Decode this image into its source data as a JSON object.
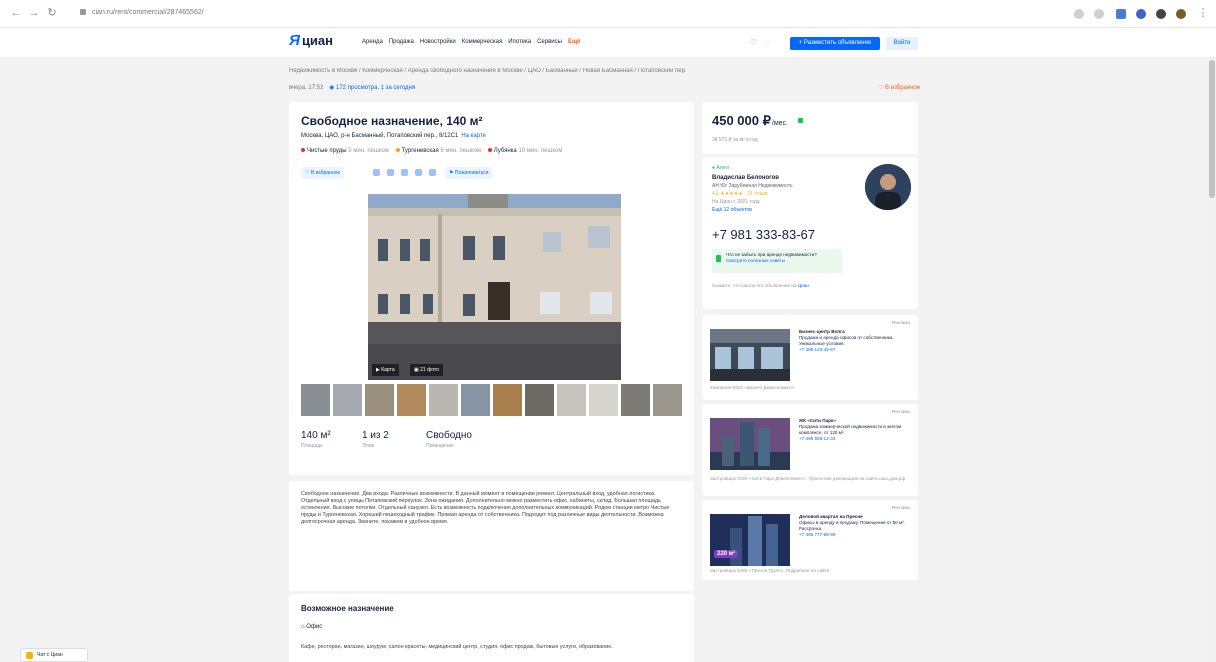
{
  "browser": {
    "back": "←",
    "forward": "→",
    "reload": "↻",
    "url": "cian.ru/rent/commercial/287465562/"
  },
  "header": {
    "logo_text": "циан",
    "menu": [
      "Аренда",
      "Продажа",
      "Новостройки",
      "Коммерческая",
      "Ипотека",
      "Сервисы"
    ],
    "menu_hot": "Ещё",
    "place_ad": "+ Разместить объявление",
    "login": "Войти"
  },
  "breadcrumbs": "Недвижимость в Москве / Коммерческая / Аренда свободного назначения в Москве / ЦАО / Басманный / Новая Басманная / Потаповский пер.",
  "meta": {
    "updated": "вчера, 17:52",
    "views": "172 просмотра, 1 за сегодня"
  },
  "favorites": "В избранное",
  "listing": {
    "title": "Свободное назначение, 140 м²",
    "address": "Москва, ЦАО, р-н Басманный, Потаповский пер., 8/12С1",
    "map_link": "На карте",
    "metro": [
      {
        "name": "Чистые пруды",
        "time": "5 мин. пешком",
        "color": "#e4312a"
      },
      {
        "name": "Тургеневская",
        "time": "6 мин. пешком",
        "color": "#f0a325"
      },
      {
        "name": "Лубянка",
        "time": "10 мин. пешком",
        "color": "#e4312a"
      }
    ],
    "actions": {
      "favorite": "В избранное",
      "report": "Пожаловаться"
    },
    "gallery": {
      "map_button": "Карта",
      "photos_button": "21 фото"
    },
    "params": [
      {
        "value": "140 м²",
        "label": "Площадь"
      },
      {
        "value": "1 из 2",
        "label": "Этаж"
      },
      {
        "value": "Свободно",
        "label": "Помещение"
      }
    ],
    "description": "Свободное назначение. Два входа. Различные возможности. В данный момент в помещении ремонт. Центральный вход, удобная логистика. Отдельный вход с улицы Потаповский переулок. Зона ожидания. Дополнительно можно разместить офис, кабинеты, склад. Большая площадь остекления. Высокие потолки. Отдельный санузел. Есть возможность подключения дополнительных коммуникаций. Рядом станции метро Чистые пруды и Тургеневская. Хороший пешеходный трафик. Прямая аренда от собственника. Подходит под различные виды деятельности. Возможна долгосрочная аренда. Звоните, покажем в удобное время.",
    "extra_title": "Возможное назначение",
    "extra_tag": "Офис",
    "extra_text": "Кафе, ресторан, магазин, шоурум, салон красоты, медицинский центр, студия, офис продаж, бытовые услуги, образование."
  },
  "sidebar": {
    "price": "450 000 ₽",
    "price_unit": "/мес.",
    "price_sub": "38 571 ₽ за м² в год",
    "agent": {
      "badge": "Агент",
      "name": "Владислав Белоногов",
      "company": "АН Юг Зарубежная Недвижимость",
      "rating": "4,5 ★★★★★ · 21 отзыв",
      "since": "На Циан с 2021 года",
      "more": "Ещё 12 объектов",
      "phone": "+7 981 333-83-67",
      "safe_text": "Что не забыть при аренде недвижимости?",
      "safe_link": "Смотрите полезные советы",
      "note": "Скажите, что нашли это объявление на",
      "note_link": "Циан"
    },
    "ads": [
      {
        "label": "Реклама",
        "title": "Бизнес-центр Волга",
        "text": "Продажа и аренда офисов от собственника. Уникальные условия.",
        "phone": "+7 495 123-45-67",
        "footer": "Компания ООО «Бизнес-Девелопмент»"
      },
      {
        "label": "Реклама",
        "title": "ЖК «Сити Парк»",
        "text": "Продажа коммерческой недвижимости в жилом комплексе, от 120 м².",
        "phone": "+7 495 555-12-34",
        "footer": "Застройщик ООО «Сити Парк Девелопмент». Проектная декларация на сайте наш.дом.рф"
      },
      {
        "label": "Реклама",
        "title": "Деловой квартал на Пресне",
        "text": "Офисы в аренду и продажу. Помещения от 50 м². Рассрочка.",
        "phone": "+7 495 777-88-99",
        "badge": "220 м²",
        "footer": "Застройщик ООО «Пресня Групп». Подробнее на сайте"
      }
    ]
  },
  "chat": "Чат с Циан",
  "colors": {
    "accent": "#0468ff",
    "hot": "#ff5c1a",
    "green": "#1bc44f"
  }
}
